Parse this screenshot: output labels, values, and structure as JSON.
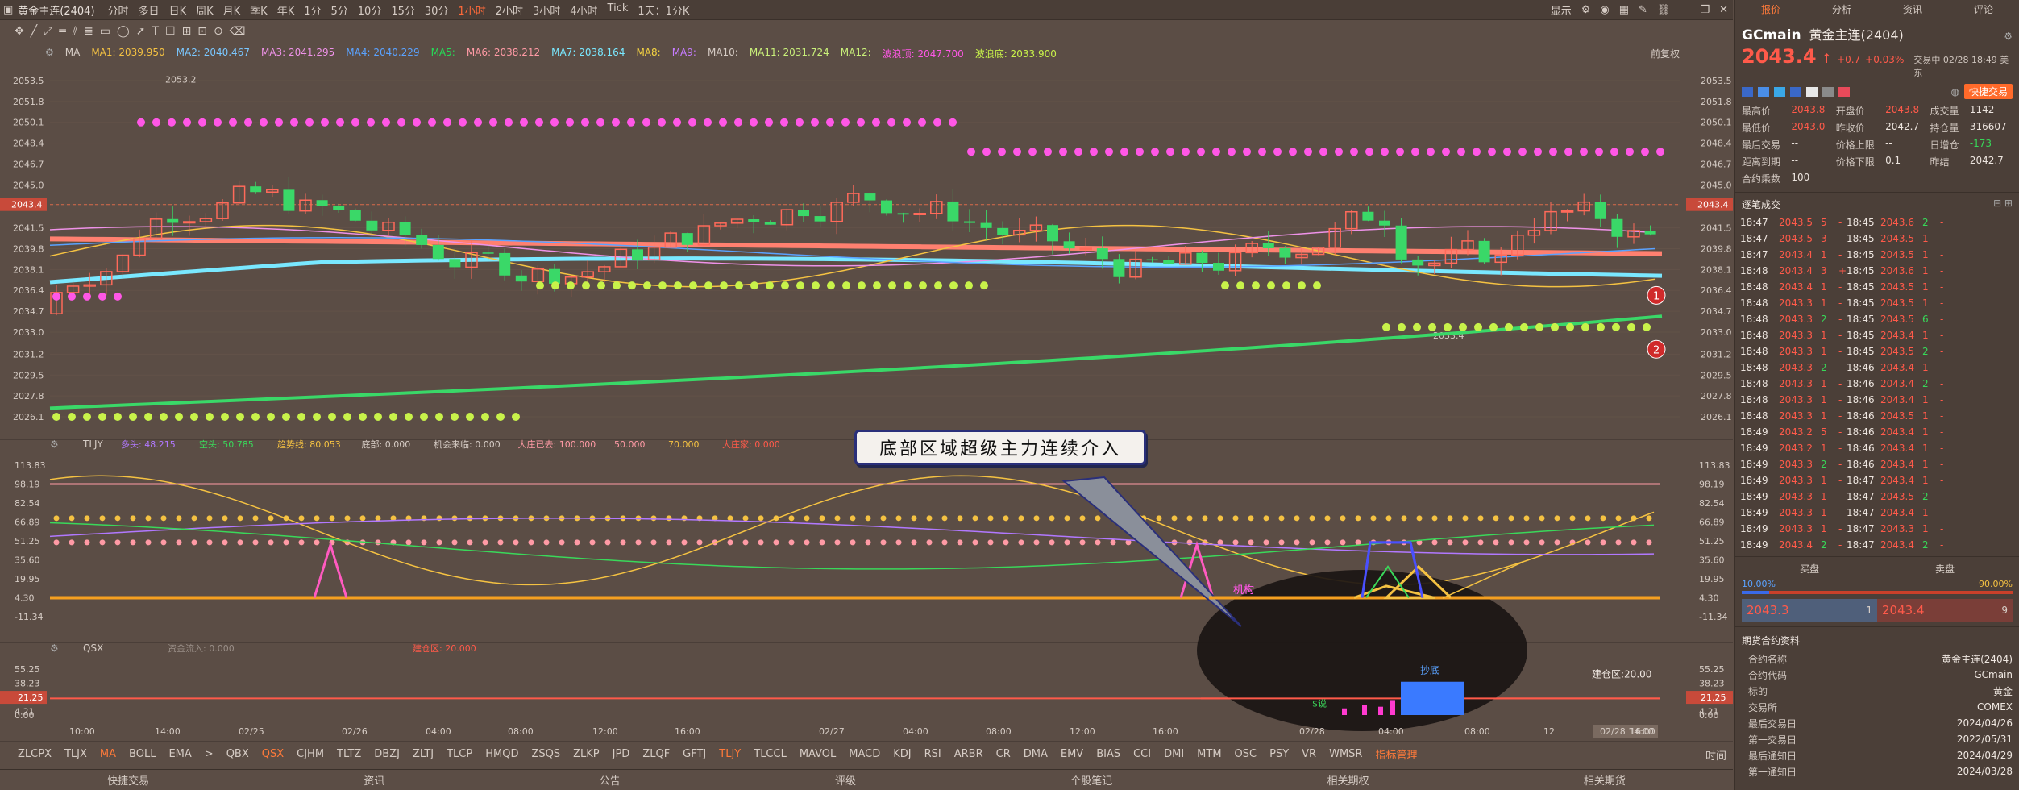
{
  "header": {
    "symbol_title": "黄金主连(2404)",
    "timeframes": [
      "分时",
      "多日",
      "1分",
      "5分",
      "10分",
      "15分",
      "30分",
      "1小时",
      "2小时",
      "3小时",
      "4小时",
      "Tick"
    ],
    "active_timeframe": "1小时",
    "extra_left": [
      "日K",
      "周K",
      "月K",
      "季K",
      "年K"
    ],
    "range_label": "1天：1分K",
    "display_label": "显示"
  },
  "ma_bar": {
    "items": [
      {
        "label": "MA1: 2039.950",
        "color": "#f5c242"
      },
      {
        "label": "MA2: 2040.467",
        "color": "#7ac7ff"
      },
      {
        "label": "MA3: 2041.295",
        "color": "#ee92e8"
      },
      {
        "label": "MA4: 2040.229",
        "color": "#5aa2ff"
      },
      {
        "label": "MA5:",
        "color": "#27d857"
      },
      {
        "label": "MA6: 2038.212",
        "color": "#ff9aa5"
      },
      {
        "label": "MA7: 2038.164",
        "color": "#79e8ff"
      },
      {
        "label": "MA8:",
        "color": "#f5d442"
      },
      {
        "label": "MA9:",
        "color": "#c67cff"
      },
      {
        "label": "MA10:",
        "color": "#d6ccc5"
      },
      {
        "label": "MA11: 2031.724",
        "color": "#c9f07a"
      },
      {
        "label": "MA12:",
        "color": "#c9f07a"
      },
      {
        "label": "波浪顶: 2047.700",
        "color": "#ff57e6"
      },
      {
        "label": "波浪底: 2033.900",
        "color": "#c8f24a"
      }
    ],
    "ma_label": "MA",
    "right_label": "前复权"
  },
  "price_axis": {
    "left": [
      "2053.5",
      "2051.8",
      "2050.1",
      "2048.4",
      "2046.7",
      "2045.0",
      "2043.4",
      "2041.5",
      "2039.8",
      "2038.1",
      "2036.4",
      "2034.7",
      "2033.0",
      "2031.2",
      "2029.5",
      "2027.8",
      "2026.1"
    ],
    "current": "2043.4",
    "high_mark": "2053.2",
    "low_mark": "2033.4"
  },
  "tljy": {
    "name": "TLJY",
    "items": [
      {
        "label": "多头: 48.215",
        "color": "#b178ff"
      },
      {
        "label": "空头: 50.785",
        "color": "#3ad85a"
      },
      {
        "label": "趋势线: 80.053",
        "color": "#f5c242"
      },
      {
        "label": "底部: 0.000",
        "color": "#d6ccc5"
      },
      {
        "label": "机会来临: 0.000",
        "color": "#d6ccc5"
      },
      {
        "label": "大庄已去: 100.000",
        "color": "#ff9aa5"
      },
      {
        "label": "50.000",
        "color": "#ff9aa5"
      },
      {
        "label": "70.000",
        "color": "#f5c242"
      },
      {
        "label": "大庄家: 0.000",
        "color": "#ff5a4a"
      }
    ],
    "axis": [
      "113.83",
      "98.19",
      "82.54",
      "66.89",
      "51.25",
      "35.60",
      "19.95",
      "4.30",
      "-11.34"
    ],
    "label_jigou": "机构"
  },
  "qsx": {
    "name": "QSX",
    "items": [
      {
        "label": "资金流入: 0.000",
        "color": "#9a8f88"
      },
      {
        "label": "建仓区: 20.000",
        "color": "#ff5a4a"
      }
    ],
    "axis": [
      "55.25",
      "38.23",
      "21.25",
      "4.21",
      "0.00"
    ],
    "current": "21.25",
    "jiancang": "建仓区:20.00",
    "chaodi": "抄底",
    "shuo": "$说"
  },
  "time_axis": [
    "10:00",
    "14:00",
    "02/25",
    "02/26",
    "04:00",
    "08:00",
    "12:00",
    "16:00",
    "02/27",
    "04:00",
    "08:00",
    "12:00",
    "16:00",
    "02/28",
    "04:00",
    "08:00",
    "12",
    "02/28 14:00",
    "16:00"
  ],
  "callout": "底部区域超级主力连续介入",
  "badges": [
    "1",
    "2"
  ],
  "bottom_indicators": [
    "ZLCPX",
    "TLJX",
    "MA",
    "BOLL",
    "EMA",
    ">",
    "QBX",
    "QSX",
    "CJHM",
    "TLTZ",
    "DBZJ",
    "ZLTJ",
    "TLCP",
    "HMQD",
    "ZSQS",
    "ZLKP",
    "JPD",
    "ZLQF",
    "GFTJ",
    "TLJY",
    "TLCCL",
    "MAVOL",
    "MACD",
    "KDJ",
    "RSI",
    "ARBR",
    "CR",
    "DMA",
    "EMV",
    "BIAS",
    "CCI",
    "DMI",
    "MTM",
    "OSC",
    "PSY",
    "VR",
    "WMSR",
    "指标管理"
  ],
  "bottom_active": [
    "MA",
    "QSX",
    "TLJY",
    "指标管理"
  ],
  "time_label": "时间",
  "bottom_tabs": [
    "快捷交易",
    "资讯",
    "公告",
    "评级",
    "个股笔记",
    "相关期权",
    "相关期货"
  ],
  "right": {
    "tabs": [
      "报价",
      "分析",
      "资讯",
      "评论"
    ],
    "code": "GCmain",
    "name": "黄金主连(2404)",
    "price": "2043.4",
    "change": "+0.7",
    "pct": "+0.03%",
    "status": "交易中 02/28 18:49 美东",
    "quick_trade": "快捷交易",
    "quote": [
      [
        "最高价",
        "2043.8",
        "开盘价",
        "2043.8",
        "成交量",
        "1142"
      ],
      [
        "最低价",
        "2043.0",
        "昨收价",
        "2042.7",
        "持仓量",
        "316607"
      ],
      [
        "最后交易",
        "--",
        "价格上限",
        "--",
        "日增仓",
        "-173"
      ],
      [
        "距离到期",
        "--",
        "价格下限",
        "0.1",
        "昨结",
        "2042.7"
      ],
      [
        "合约乘数",
        "100",
        "",
        "",
        "",
        ""
      ]
    ],
    "ticks_title": "逐笔成交",
    "ticks": [
      [
        "18:47",
        "2043.5",
        "5",
        "-",
        "18:45",
        "2043.6",
        "2",
        "-"
      ],
      [
        "18:47",
        "2043.5",
        "3",
        "-",
        "18:45",
        "2043.5",
        "1",
        "-"
      ],
      [
        "18:47",
        "2043.4",
        "1",
        "-",
        "18:45",
        "2043.5",
        "1",
        "-"
      ],
      [
        "18:48",
        "2043.4",
        "3",
        "+",
        "18:45",
        "2043.6",
        "1",
        "-"
      ],
      [
        "18:48",
        "2043.4",
        "1",
        "-",
        "18:45",
        "2043.5",
        "1",
        "-"
      ],
      [
        "18:48",
        "2043.3",
        "1",
        "-",
        "18:45",
        "2043.5",
        "1",
        "-"
      ],
      [
        "18:48",
        "2043.3",
        "2",
        "-",
        "18:45",
        "2043.5",
        "6",
        "-"
      ],
      [
        "18:48",
        "2043.3",
        "1",
        "-",
        "18:45",
        "2043.4",
        "1",
        "-"
      ],
      [
        "18:48",
        "2043.3",
        "1",
        "-",
        "18:45",
        "2043.5",
        "2",
        "-"
      ],
      [
        "18:48",
        "2043.3",
        "2",
        "-",
        "18:46",
        "2043.4",
        "1",
        "-"
      ],
      [
        "18:48",
        "2043.3",
        "1",
        "-",
        "18:46",
        "2043.4",
        "2",
        "-"
      ],
      [
        "18:48",
        "2043.3",
        "1",
        "-",
        "18:46",
        "2043.4",
        "1",
        "-"
      ],
      [
        "18:48",
        "2043.3",
        "1",
        "-",
        "18:46",
        "2043.5",
        "1",
        "-"
      ],
      [
        "18:49",
        "2043.2",
        "5",
        "-",
        "18:46",
        "2043.4",
        "1",
        "-"
      ],
      [
        "18:49",
        "2043.2",
        "1",
        "-",
        "18:46",
        "2043.4",
        "1",
        "-"
      ],
      [
        "18:49",
        "2043.3",
        "2",
        "-",
        "18:46",
        "2043.4",
        "1",
        "-"
      ],
      [
        "18:49",
        "2043.3",
        "1",
        "-",
        "18:47",
        "2043.4",
        "1",
        "-"
      ],
      [
        "18:49",
        "2043.3",
        "1",
        "-",
        "18:47",
        "2043.5",
        "2",
        "-"
      ],
      [
        "18:49",
        "2043.3",
        "1",
        "-",
        "18:47",
        "2043.4",
        "1",
        "-"
      ],
      [
        "18:49",
        "2043.3",
        "1",
        "-",
        "18:47",
        "2043.3",
        "1",
        "-"
      ],
      [
        "18:49",
        "2043.4",
        "2",
        "-",
        "18:47",
        "2043.4",
        "2",
        "-"
      ]
    ],
    "buy_label": "买盘",
    "sell_label": "卖盘",
    "buy_pct": "10.00%",
    "sell_pct": "90.00%",
    "buy_price": "2043.3",
    "buy_qty": "1",
    "sell_price": "2043.4",
    "sell_qty": "9",
    "contract_title": "期货合约资料",
    "contract": [
      [
        "合约名称",
        "黄金主连(2404)"
      ],
      [
        "合约代码",
        "GCmain"
      ],
      [
        "标的",
        "黄金"
      ],
      [
        "交易所",
        "COMEX"
      ],
      [
        "最后交易日",
        "2024/04/26"
      ],
      [
        "第一交易日",
        "2022/05/31"
      ],
      [
        "最后通知日",
        "2024/04/29"
      ],
      [
        "第一通知日",
        "2024/03/28"
      ]
    ]
  }
}
